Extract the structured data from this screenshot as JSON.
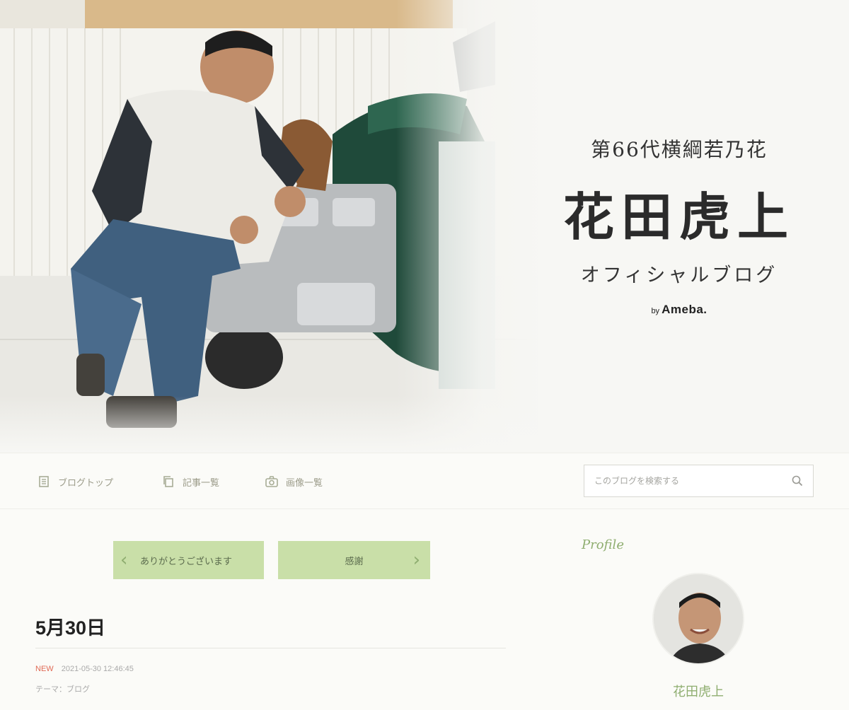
{
  "header": {
    "subtitle": "第66代横綱若乃花",
    "title": "花田虎上",
    "blog_label": "オフィシャルブログ",
    "by_label": "by",
    "brand": "Ameba."
  },
  "nav": {
    "items": [
      {
        "label": "ブログトップ",
        "icon": "document-icon"
      },
      {
        "label": "記事一覧",
        "icon": "copy-icon"
      },
      {
        "label": "画像一覧",
        "icon": "camera-icon"
      }
    ],
    "search": {
      "placeholder": "このブログを検索する",
      "icon": "search-icon"
    }
  },
  "pager": {
    "prev_label": "ありがとうございます",
    "next_label": "感謝"
  },
  "entry": {
    "title": "5月30日",
    "new_badge": "NEW",
    "datetime": "2021-05-30 12:46:45",
    "theme": "テーマ：ブログ"
  },
  "sidebar": {
    "profile_heading": "Profile",
    "profile_name": "花田虎上"
  },
  "colors": {
    "accent_green": "#c9dfa8",
    "accent_text_green": "#8fae70",
    "new_badge": "#e06a55"
  }
}
